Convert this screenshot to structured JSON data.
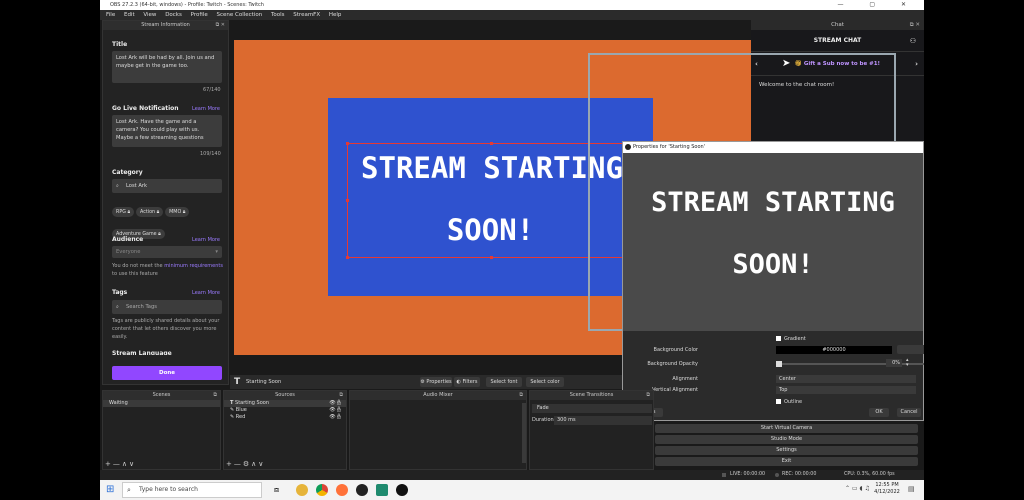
{
  "window": {
    "title": "OBS 27.2.3 (64-bit, windows) - Profile: Twitch - Scenes: Twitch",
    "controls": "—  ▢  ✕"
  },
  "menu": [
    "File",
    "Edit",
    "View",
    "Docks",
    "Profile",
    "Scene Collection",
    "Tools",
    "StreamFX",
    "Help"
  ],
  "stream_info": {
    "header": "Stream Information",
    "title_label": "Title",
    "title_value": "Lost Ark will be had by all. Join us and maybe get in the game too.",
    "title_count": "67/140",
    "notif_label": "Go Live Notification",
    "learn_more": "Learn More",
    "notif_value": "Lost Ark. Have the game and a camera? You could play with us. Maybe a few streaming questions",
    "notif_count": "109/140",
    "category_label": "Category",
    "category_value": "Lost Ark",
    "chips": [
      "RPG",
      "Action",
      "MMO",
      "Adventure Game"
    ],
    "audience_label": "Audience",
    "audience_value": "Everyone",
    "audience_note_1": "You do not meet the",
    "audience_note_link": "minimum requirements",
    "audience_note_2": "to use this feature",
    "tags_label": "Tags",
    "tags_placeholder": "Search Tags",
    "tags_note": "Tags are publicly shared details about your content that let others discover you more easily.",
    "stream_language": "Stream Language",
    "done": "Done"
  },
  "preview": {
    "line1": "STREAM STARTING",
    "line2": "SOON!",
    "colors": {
      "orange": "#dc6a2f",
      "blue": "#2f52cf",
      "selection": "#e53935"
    }
  },
  "source_bar": {
    "source_name": "Starting Soon",
    "properties": "Properties",
    "filters": "Filters",
    "select_font": "Select font",
    "select_color": "Select color"
  },
  "chat": {
    "dock_title": "Chat",
    "title": "STREAM CHAT",
    "sub_banner": "Gift a Sub now to be #1!",
    "welcome": "Welcome to the chat room!"
  },
  "properties": {
    "title": "Properties for 'Starting Soon'",
    "preview_line1": "STREAM STARTING",
    "preview_line2": "SOON!",
    "gradient": "Gradient",
    "bg_color_label": "Background Color",
    "bg_color_value": "#000000",
    "select_color": "Select color",
    "bg_opacity_label": "Background Opacity",
    "bg_opacity_value": "0%",
    "alignment_label": "Alignment",
    "alignment_value": "Center",
    "valign_label": "Vertical Alignment",
    "valign_value": "Top",
    "outline": "Outline",
    "defaults": "Defaults",
    "ok": "OK",
    "cancel": "Cancel"
  },
  "docks": {
    "scenes_title": "Scenes",
    "scenes": [
      "Waiting"
    ],
    "sources_title": "Sources",
    "sources": [
      "Starting Soon",
      "Blue",
      "Red"
    ],
    "mixer_title": "Audio Mixer",
    "transitions_title": "Scene Transitions",
    "transition": "Fade",
    "duration_label": "Duration",
    "duration_value": "300 ms",
    "controls": [
      "+",
      "—",
      "∧",
      "∨"
    ]
  },
  "controls": [
    "Start Virtual Camera",
    "Studio Mode",
    "Settings",
    "Exit"
  ],
  "status": {
    "live": "LIVE: 00:00:00",
    "rec": "REC: 00:00:00",
    "cpu": "CPU: 0.3%, 60.00 fps"
  },
  "taskbar": {
    "search_placeholder": "Type here to search",
    "time": "12:55 PM",
    "date": "4/12/2022"
  }
}
